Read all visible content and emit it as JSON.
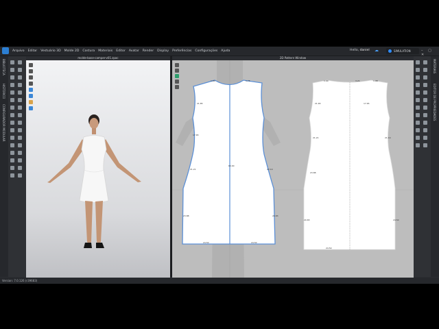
{
  "menubar": {
    "items": [
      "Arquivo",
      "Editar",
      "Vestuário 3D",
      "Molde 2D",
      "Costura",
      "Materiais",
      "Editor",
      "Avatar",
      "Render",
      "Display",
      "Preferências",
      "Configurações",
      "Ajuda"
    ],
    "greeting": "Hello,",
    "username": "daniel",
    "simulation_label": "SIMULATION"
  },
  "left_tabs": [
    "BIBLIOTECA",
    "HISTÓRICO",
    "CONFIGURADOR MODULAR"
  ],
  "right_tabs": [
    "MATERIAIS",
    "EDITOR DE PROPRIEDADES"
  ],
  "view3d": {
    "title": "molde-base-camper-v01.zpac"
  },
  "view2d": {
    "title": "2D Pattern Window"
  },
  "pattern_front": {
    "labels": [
      "1.80",
      "1.75",
      "21.85",
      "17.65",
      "21.21",
      "60.00",
      "22.19",
      "23.88",
      "20.83",
      "24.50",
      "24.50"
    ]
  },
  "pattern_back": {
    "labels": [
      "1.90",
      "3.21",
      "1.98",
      "21.65",
      "17.65",
      "21.21",
      "21.19",
      "23.88",
      "20.83",
      "24.50",
      "24.50"
    ]
  },
  "status": {
    "version": "Version: 7.0.126 (r39683)"
  },
  "colors": {
    "accent": "#2f8cff",
    "pattern_outline_selected": "#5b8fd6"
  }
}
